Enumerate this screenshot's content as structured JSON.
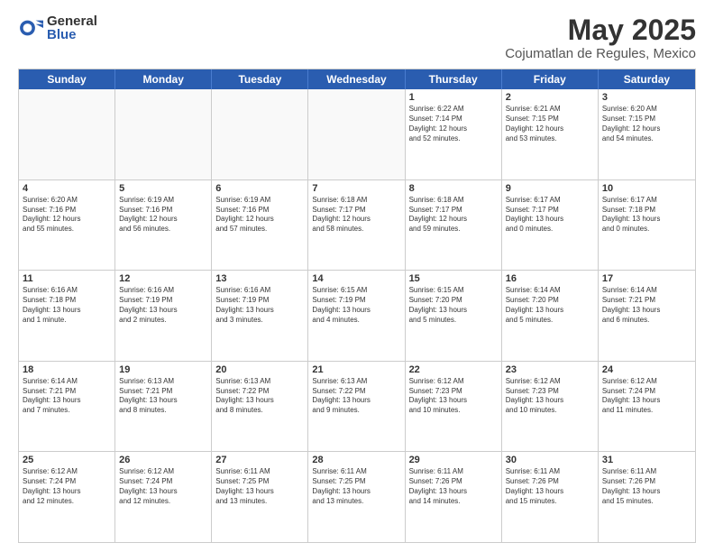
{
  "logo": {
    "general": "General",
    "blue": "Blue"
  },
  "title": "May 2025",
  "location": "Cojumatlan de Regules, Mexico",
  "weekdays": [
    "Sunday",
    "Monday",
    "Tuesday",
    "Wednesday",
    "Thursday",
    "Friday",
    "Saturday"
  ],
  "rows": [
    [
      {
        "day": "",
        "info": ""
      },
      {
        "day": "",
        "info": ""
      },
      {
        "day": "",
        "info": ""
      },
      {
        "day": "",
        "info": ""
      },
      {
        "day": "1",
        "info": "Sunrise: 6:22 AM\nSunset: 7:14 PM\nDaylight: 12 hours\nand 52 minutes."
      },
      {
        "day": "2",
        "info": "Sunrise: 6:21 AM\nSunset: 7:15 PM\nDaylight: 12 hours\nand 53 minutes."
      },
      {
        "day": "3",
        "info": "Sunrise: 6:20 AM\nSunset: 7:15 PM\nDaylight: 12 hours\nand 54 minutes."
      }
    ],
    [
      {
        "day": "4",
        "info": "Sunrise: 6:20 AM\nSunset: 7:16 PM\nDaylight: 12 hours\nand 55 minutes."
      },
      {
        "day": "5",
        "info": "Sunrise: 6:19 AM\nSunset: 7:16 PM\nDaylight: 12 hours\nand 56 minutes."
      },
      {
        "day": "6",
        "info": "Sunrise: 6:19 AM\nSunset: 7:16 PM\nDaylight: 12 hours\nand 57 minutes."
      },
      {
        "day": "7",
        "info": "Sunrise: 6:18 AM\nSunset: 7:17 PM\nDaylight: 12 hours\nand 58 minutes."
      },
      {
        "day": "8",
        "info": "Sunrise: 6:18 AM\nSunset: 7:17 PM\nDaylight: 12 hours\nand 59 minutes."
      },
      {
        "day": "9",
        "info": "Sunrise: 6:17 AM\nSunset: 7:17 PM\nDaylight: 13 hours\nand 0 minutes."
      },
      {
        "day": "10",
        "info": "Sunrise: 6:17 AM\nSunset: 7:18 PM\nDaylight: 13 hours\nand 0 minutes."
      }
    ],
    [
      {
        "day": "11",
        "info": "Sunrise: 6:16 AM\nSunset: 7:18 PM\nDaylight: 13 hours\nand 1 minute."
      },
      {
        "day": "12",
        "info": "Sunrise: 6:16 AM\nSunset: 7:19 PM\nDaylight: 13 hours\nand 2 minutes."
      },
      {
        "day": "13",
        "info": "Sunrise: 6:16 AM\nSunset: 7:19 PM\nDaylight: 13 hours\nand 3 minutes."
      },
      {
        "day": "14",
        "info": "Sunrise: 6:15 AM\nSunset: 7:19 PM\nDaylight: 13 hours\nand 4 minutes."
      },
      {
        "day": "15",
        "info": "Sunrise: 6:15 AM\nSunset: 7:20 PM\nDaylight: 13 hours\nand 5 minutes."
      },
      {
        "day": "16",
        "info": "Sunrise: 6:14 AM\nSunset: 7:20 PM\nDaylight: 13 hours\nand 5 minutes."
      },
      {
        "day": "17",
        "info": "Sunrise: 6:14 AM\nSunset: 7:21 PM\nDaylight: 13 hours\nand 6 minutes."
      }
    ],
    [
      {
        "day": "18",
        "info": "Sunrise: 6:14 AM\nSunset: 7:21 PM\nDaylight: 13 hours\nand 7 minutes."
      },
      {
        "day": "19",
        "info": "Sunrise: 6:13 AM\nSunset: 7:21 PM\nDaylight: 13 hours\nand 8 minutes."
      },
      {
        "day": "20",
        "info": "Sunrise: 6:13 AM\nSunset: 7:22 PM\nDaylight: 13 hours\nand 8 minutes."
      },
      {
        "day": "21",
        "info": "Sunrise: 6:13 AM\nSunset: 7:22 PM\nDaylight: 13 hours\nand 9 minutes."
      },
      {
        "day": "22",
        "info": "Sunrise: 6:12 AM\nSunset: 7:23 PM\nDaylight: 13 hours\nand 10 minutes."
      },
      {
        "day": "23",
        "info": "Sunrise: 6:12 AM\nSunset: 7:23 PM\nDaylight: 13 hours\nand 10 minutes."
      },
      {
        "day": "24",
        "info": "Sunrise: 6:12 AM\nSunset: 7:24 PM\nDaylight: 13 hours\nand 11 minutes."
      }
    ],
    [
      {
        "day": "25",
        "info": "Sunrise: 6:12 AM\nSunset: 7:24 PM\nDaylight: 13 hours\nand 12 minutes."
      },
      {
        "day": "26",
        "info": "Sunrise: 6:12 AM\nSunset: 7:24 PM\nDaylight: 13 hours\nand 12 minutes."
      },
      {
        "day": "27",
        "info": "Sunrise: 6:11 AM\nSunset: 7:25 PM\nDaylight: 13 hours\nand 13 minutes."
      },
      {
        "day": "28",
        "info": "Sunrise: 6:11 AM\nSunset: 7:25 PM\nDaylight: 13 hours\nand 13 minutes."
      },
      {
        "day": "29",
        "info": "Sunrise: 6:11 AM\nSunset: 7:26 PM\nDaylight: 13 hours\nand 14 minutes."
      },
      {
        "day": "30",
        "info": "Sunrise: 6:11 AM\nSunset: 7:26 PM\nDaylight: 13 hours\nand 15 minutes."
      },
      {
        "day": "31",
        "info": "Sunrise: 6:11 AM\nSunset: 7:26 PM\nDaylight: 13 hours\nand 15 minutes."
      }
    ]
  ]
}
